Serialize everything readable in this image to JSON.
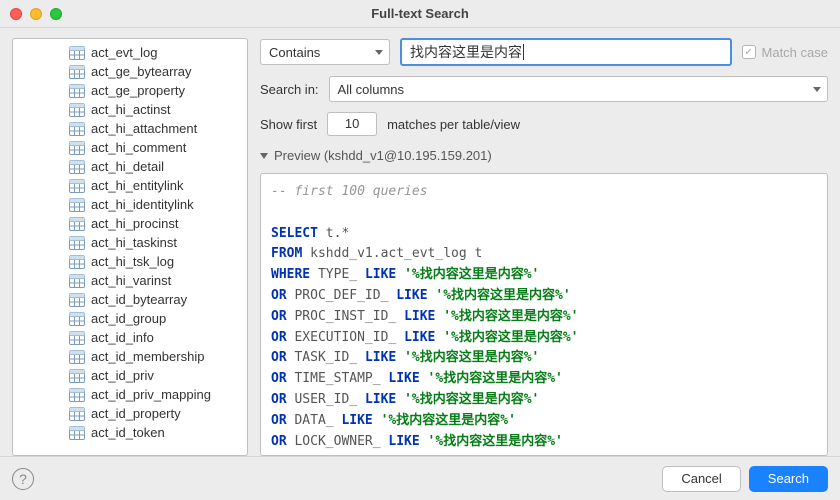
{
  "titlebar": {
    "title": "Full-text Search"
  },
  "sidebar": {
    "items": [
      {
        "label": "act_evt_log"
      },
      {
        "label": "act_ge_bytearray"
      },
      {
        "label": "act_ge_property"
      },
      {
        "label": "act_hi_actinst"
      },
      {
        "label": "act_hi_attachment"
      },
      {
        "label": "act_hi_comment"
      },
      {
        "label": "act_hi_detail"
      },
      {
        "label": "act_hi_entitylink"
      },
      {
        "label": "act_hi_identitylink"
      },
      {
        "label": "act_hi_procinst"
      },
      {
        "label": "act_hi_taskinst"
      },
      {
        "label": "act_hi_tsk_log"
      },
      {
        "label": "act_hi_varinst"
      },
      {
        "label": "act_id_bytearray"
      },
      {
        "label": "act_id_group"
      },
      {
        "label": "act_id_info"
      },
      {
        "label": "act_id_membership"
      },
      {
        "label": "act_id_priv"
      },
      {
        "label": "act_id_priv_mapping"
      },
      {
        "label": "act_id_property"
      },
      {
        "label": "act_id_token"
      }
    ]
  },
  "search": {
    "mode": "Contains",
    "value": "找内容这里是内容",
    "match_case_label": "Match case",
    "match_case_checked": true
  },
  "search_in": {
    "label": "Search in:",
    "value": "All columns"
  },
  "show_first": {
    "label": "Show first",
    "value": "10",
    "suffix": "matches per table/view"
  },
  "preview": {
    "title": "Preview (kshdd_v1@10.195.159.201)",
    "comment": "-- first 100 queries",
    "lines": [
      {
        "k": "SELECT",
        "rest": " t.*"
      },
      {
        "k": "FROM",
        "rest": " kshdd_v1.act_evt_log t"
      },
      {
        "k": "WHERE",
        "col": " TYPE_ ",
        "op": "LIKE",
        "str": " '%找内容这里是内容%'"
      },
      {
        "k": "OR",
        "col": " PROC_DEF_ID_ ",
        "op": "LIKE",
        "str": " '%找内容这里是内容%'"
      },
      {
        "k": "OR",
        "col": " PROC_INST_ID_ ",
        "op": "LIKE",
        "str": " '%找内容这里是内容%'"
      },
      {
        "k": "OR",
        "col": " EXECUTION_ID_ ",
        "op": "LIKE",
        "str": " '%找内容这里是内容%'"
      },
      {
        "k": "OR",
        "col": " TASK_ID_ ",
        "op": "LIKE",
        "str": " '%找内容这里是内容%'"
      },
      {
        "k": "OR",
        "col": " TIME_STAMP_ ",
        "op": "LIKE",
        "str": " '%找内容这里是内容%'"
      },
      {
        "k": "OR",
        "col": " USER_ID_ ",
        "op": "LIKE",
        "str": " '%找内容这里是内容%'"
      },
      {
        "k": "OR",
        "col": " DATA_ ",
        "op": "LIKE",
        "str": " '%找内容这里是内容%'"
      },
      {
        "k": "OR",
        "col": " LOCK_OWNER_ ",
        "op": "LIKE",
        "str": " '%找内容这里是内容%'"
      }
    ]
  },
  "footer": {
    "cancel": "Cancel",
    "search": "Search"
  }
}
